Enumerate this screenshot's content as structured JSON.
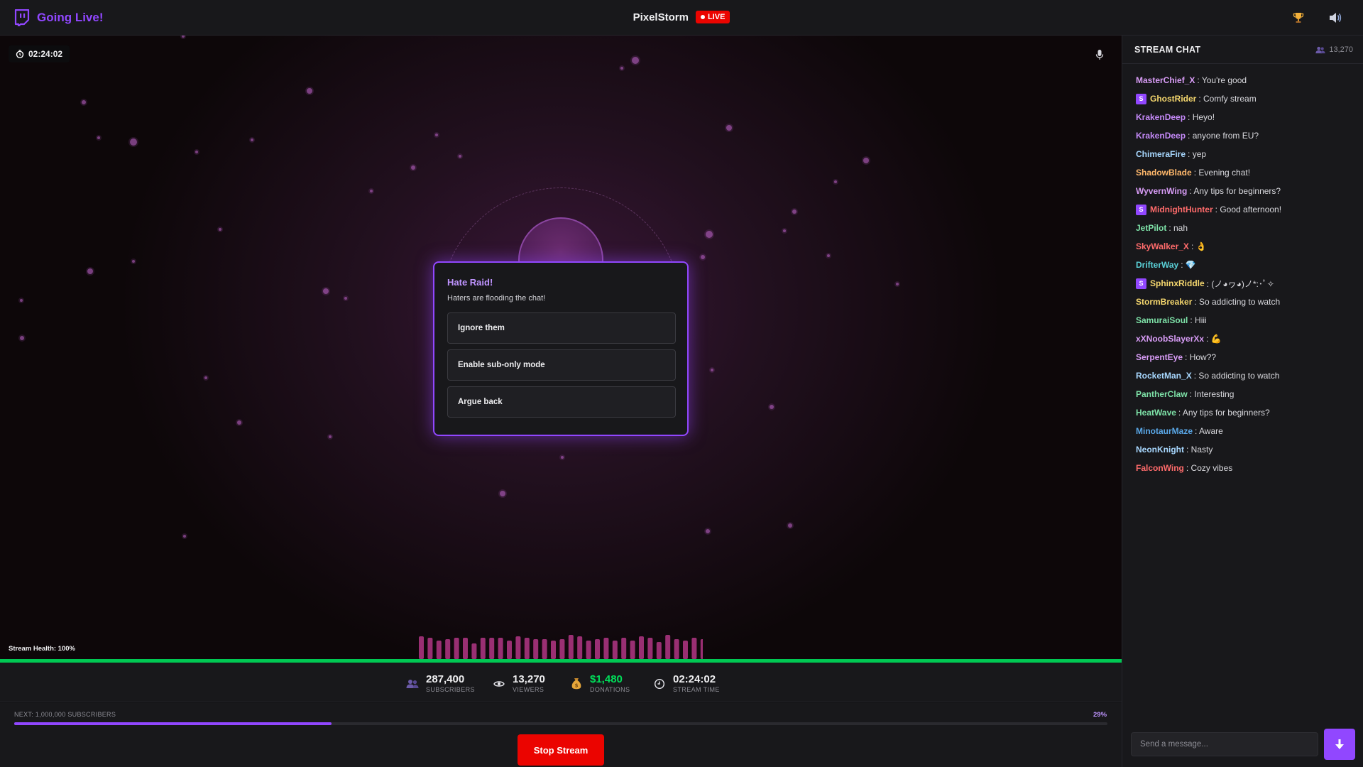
{
  "header": {
    "app_title": "Going Live!",
    "streamer_name": "PixelStorm",
    "live_label": "LIVE",
    "icons": [
      "logo-icon",
      "trophy-icon",
      "speaker-icon"
    ]
  },
  "stage": {
    "timer": "02:24:02",
    "health_label": "Stream Health: 100%",
    "health_fraction": 1.0
  },
  "modal": {
    "title": "Hate Raid!",
    "subtitle": "Haters are flooding the chat!",
    "choices": [
      "Ignore them",
      "Enable sub-only mode",
      "Argue back"
    ]
  },
  "stats": {
    "subscribers": {
      "value": "287,400",
      "label": "SUBSCRIBERS"
    },
    "viewers": {
      "value": "13,270",
      "label": "VIEWERS"
    },
    "donations": {
      "value": "$1,480",
      "label": "DONATIONS"
    },
    "stream_time": {
      "value": "02:24:02",
      "label": "STREAM TIME"
    }
  },
  "progress": {
    "label": "NEXT: 1,000,000 SUBSCRIBERS",
    "percent_label": "29%",
    "fraction": 0.29
  },
  "stop_button": "Stop Stream",
  "chat": {
    "title": "STREAM CHAT",
    "viewer_count": "13,270",
    "placeholder": "Send a message...",
    "messages": [
      {
        "user": "MasterChief_X",
        "text": ": You're good",
        "color": "#d89cf6",
        "sub": false
      },
      {
        "user": "GhostRider",
        "text": ": Comfy stream",
        "color": "#f5d76e",
        "sub": true
      },
      {
        "user": "KrakenDeep",
        "text": ": Heyo!",
        "color": "#c58af9",
        "sub": false
      },
      {
        "user": "KrakenDeep",
        "text": ": anyone from EU?",
        "color": "#c58af9",
        "sub": false
      },
      {
        "user": "ChimeraFire",
        "text": ": yep",
        "color": "#a8d8ff",
        "sub": false
      },
      {
        "user": "ShadowBlade",
        "text": ": Evening chat!",
        "color": "#ffb86b",
        "sub": false
      },
      {
        "user": "WyvernWing",
        "text": ": Any tips for beginners?",
        "color": "#d89cf6",
        "sub": false
      },
      {
        "user": "MidnightHunter",
        "text": ": Good afternoon!",
        "color": "#ff6b6b",
        "sub": true
      },
      {
        "user": "JetPilot",
        "text": ": nah",
        "color": "#7ee2a8",
        "sub": false
      },
      {
        "user": "SkyWalker_X",
        "text": ": 👌",
        "color": "#ff6b6b",
        "sub": false
      },
      {
        "user": "DrifterWay",
        "text": ": 💎",
        "color": "#5ad1d8",
        "sub": false
      },
      {
        "user": "SphinxRiddle",
        "text": ": (ノ◕ヮ◕)ノ*:･ﾟ✧",
        "color": "#f5d76e",
        "sub": true
      },
      {
        "user": "StormBreaker",
        "text": ": So addicting to watch",
        "color": "#f5d76e",
        "sub": false
      },
      {
        "user": "SamuraiSoul",
        "text": ": Hiii",
        "color": "#7ee2a8",
        "sub": false
      },
      {
        "user": "xXNoobSlayerXx",
        "text": ": 💪",
        "color": "#d89cf6",
        "sub": false
      },
      {
        "user": "SerpentEye",
        "text": ": How??",
        "color": "#d89cf6",
        "sub": false
      },
      {
        "user": "RocketMan_X",
        "text": ": So addicting to watch",
        "color": "#a8d8ff",
        "sub": false
      },
      {
        "user": "PantherClaw",
        "text": ": Interesting",
        "color": "#7ee2a8",
        "sub": false
      },
      {
        "user": "HeatWave",
        "text": ": Any tips for beginners?",
        "color": "#7ee2a8",
        "sub": false
      },
      {
        "user": "MinotaurMaze",
        "text": ": Aware",
        "color": "#5aa8e8",
        "sub": false
      },
      {
        "user": "NeonKnight",
        "text": ": Nasty",
        "color": "#a8d8ff",
        "sub": false
      },
      {
        "user": "FalconWing",
        "text": ": Cozy vibes",
        "color": "#ff6b6b",
        "sub": false
      }
    ]
  },
  "colors": {
    "accent": "#9147ff",
    "live_red": "#eb0400",
    "health_green": "#00c853",
    "donation_green": "#00e05a"
  }
}
